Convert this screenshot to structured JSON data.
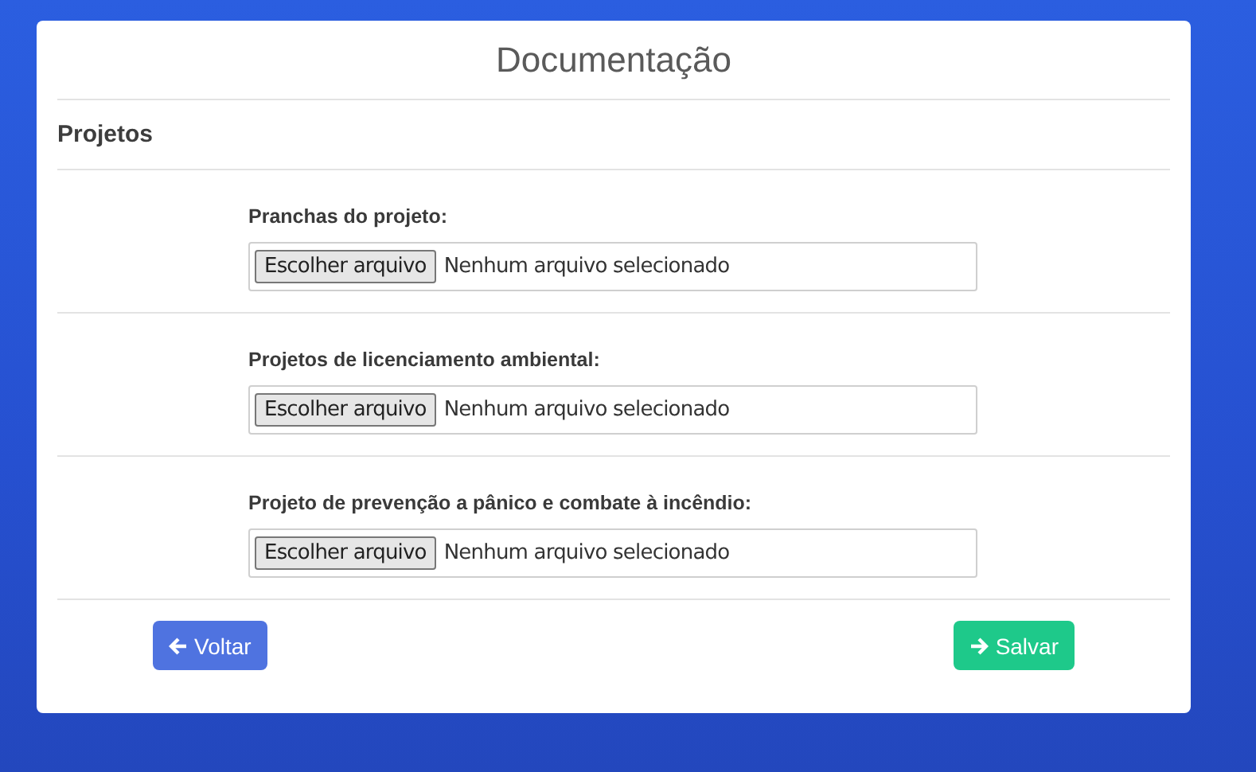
{
  "title": "Documentação",
  "section": "Projetos",
  "fields": [
    {
      "label": "Pranchas do projeto:",
      "button": "Escolher arquivo",
      "status": "Nenhum arquivo selecionado"
    },
    {
      "label": "Projetos de licenciamento ambiental:",
      "button": "Escolher arquivo",
      "status": "Nenhum arquivo selecionado"
    },
    {
      "label": "Projeto de prevenção a pânico e combate à incêndio:",
      "button": "Escolher arquivo",
      "status": "Nenhum arquivo selecionado"
    }
  ],
  "actions": [
    {
      "kind": "back",
      "label": "Voltar"
    },
    {
      "kind": "save",
      "label": "Salvar"
    }
  ]
}
